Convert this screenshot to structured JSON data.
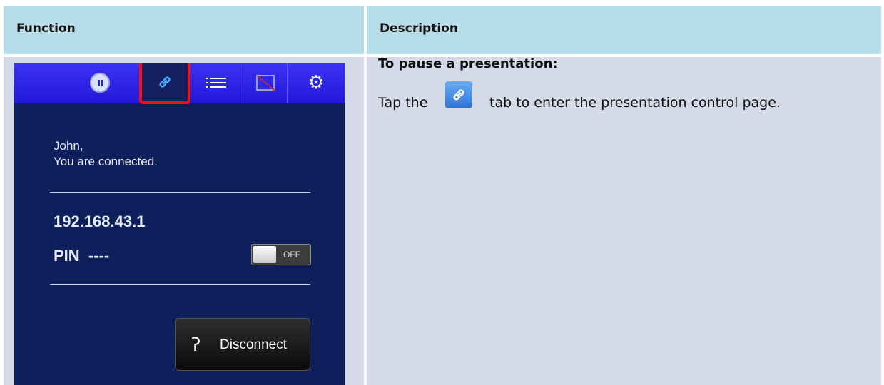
{
  "table": {
    "header_function": "Function",
    "header_description": "Description"
  },
  "phone": {
    "tabs": [
      "pause-icon",
      "link-icon",
      "list-icon",
      "screen-off-icon",
      "gear-icon"
    ],
    "greeting_line1": "John,",
    "greeting_line2": "You are connected.",
    "ip": "192.168.43.1",
    "pin_label": "PIN",
    "pin_value": "----",
    "toggle_label": "OFF",
    "disconnect_label": "Disconnect",
    "colors": {
      "tabbar": "#2a22e6",
      "panel": "#0e1f5b",
      "highlight": "#e8141c"
    }
  },
  "description": {
    "title": "To pause a presentation:",
    "line_prefix": "Tap the",
    "line_suffix": "tab to enter the presentation control page."
  }
}
